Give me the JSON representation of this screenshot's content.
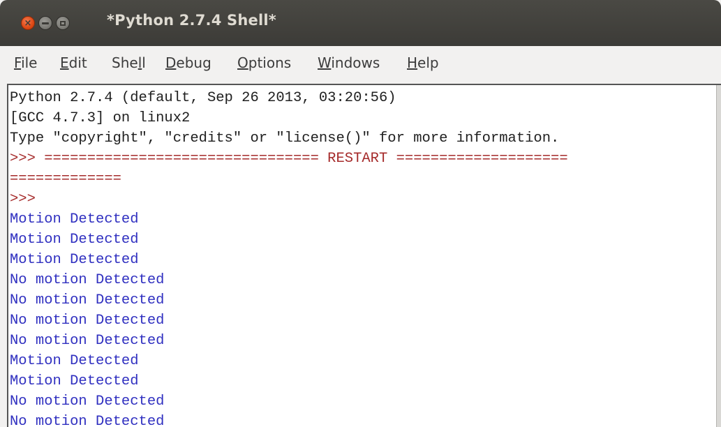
{
  "window": {
    "title": "*Python 2.7.4 Shell*",
    "buttons": {
      "close": "×"
    }
  },
  "menu": [
    {
      "pre": "",
      "mn": "F",
      "post": "ile"
    },
    {
      "pre": "",
      "mn": "E",
      "post": "dit"
    },
    {
      "pre": "She",
      "mn": "l",
      "post": "l"
    },
    {
      "pre": "",
      "mn": "D",
      "post": "ebug"
    },
    {
      "pre": "",
      "mn": "O",
      "post": "ptions"
    },
    {
      "pre": "",
      "mn": "W",
      "post": "indows"
    },
    {
      "pre": "",
      "mn": "H",
      "post": "elp"
    }
  ],
  "shell": {
    "lines": [
      "Python 2.7.4 (default, Sep 26 2013, 03:20:56)",
      "[GCC 4.7.3] on linux2",
      "Type \"copyright\", \"credits\" or \"license()\" for more information.",
      ">>> ================================ RESTART ====================",
      "=============",
      ">>> ",
      "Motion Detected",
      "Motion Detected",
      "Motion Detected",
      "No motion Detected",
      "No motion Detected",
      "No motion Detected",
      "No motion Detected",
      "Motion Detected",
      "Motion Detected",
      "No motion Detected",
      "No motion Detected"
    ]
  },
  "colors": {
    "output": "#202020",
    "prompt": "#a52a2a",
    "stdout": "#3030c0",
    "titlebar": "#3c3b37",
    "close_button": "#dd4814"
  }
}
